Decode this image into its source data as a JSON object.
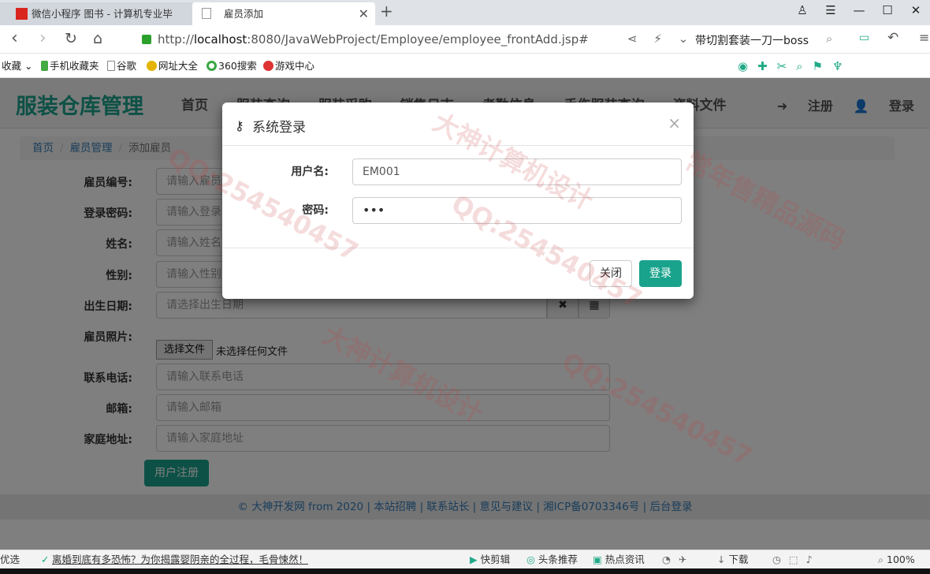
{
  "browser": {
    "tabs": [
      {
        "title": "微信小程序 图书 - 计算机专业毕"
      },
      {
        "title": "雇员添加"
      }
    ],
    "new_tab": "+",
    "url_prefix": "http://",
    "url_host": "localhost",
    "url_rest": ":8080/JavaWebProject/Employee/employee_frontAdd.jsp#",
    "search_text": "带切割套装一刀一boss",
    "bookmarks": [
      "收藏",
      "手机收藏夹",
      "谷歌",
      "网址大全",
      "360搜索",
      "游戏中心"
    ],
    "zoom": "100%"
  },
  "site": {
    "brand": "服装仓库管理",
    "menu": [
      "首页",
      "服装查询",
      "服装采购",
      "销售日志",
      "考勤信息",
      "手伤服装查询",
      "资料文件"
    ],
    "register_link": "注册",
    "login_link": "登录"
  },
  "breadcrumb": {
    "home": "首页",
    "section": "雇员管理",
    "current": "添加雇员"
  },
  "form": {
    "fields": [
      {
        "label": "雇员编号:",
        "placeholder": "请输入雇员编号"
      },
      {
        "label": "登录密码:",
        "placeholder": "请输入登录密码"
      },
      {
        "label": "姓名:",
        "placeholder": "请输入姓名"
      },
      {
        "label": "性别:",
        "placeholder": "请输入性别"
      },
      {
        "label": "出生日期:",
        "placeholder": "请选择出生日期"
      },
      {
        "label": "雇员照片:",
        "placeholder": ""
      },
      {
        "label": "联系电话:",
        "placeholder": "请输入联系电话"
      },
      {
        "label": "邮箱:",
        "placeholder": "请输入邮箱"
      },
      {
        "label": "家庭地址:",
        "placeholder": "请输入家庭地址"
      }
    ],
    "file_button": "选择文件",
    "file_status": "未选择任何文件",
    "date_clear": "✖",
    "date_calendar": "▦",
    "submit": "用户注册"
  },
  "footer": "© 大神开发网 from 2020 | 本站招聘 | 联系站长 | 意见与建议 | 湘ICP备0703346号 | 后台登录",
  "modal": {
    "title": "系统登录",
    "username_label": "用户名:",
    "username_value": "EM001",
    "password_label": "密码:",
    "password_value": "•••",
    "close_button": "关闭",
    "login_button": "登录"
  },
  "statusbar": {
    "left": "优选",
    "news": "离婚到底有多恐怖？为你揭露婴阴亲的全过程，毛骨悚然！",
    "items": [
      "快剪辑",
      "头条推荐",
      "热点资讯",
      "下载"
    ]
  },
  "colors": {
    "accent": "#1aa38c",
    "link": "#337ab7"
  }
}
